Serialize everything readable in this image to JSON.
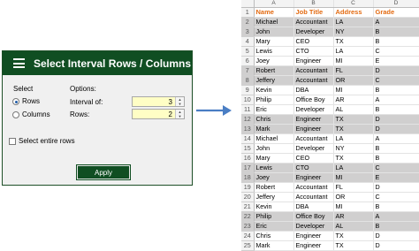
{
  "dialog": {
    "title": "Select Interval Rows / Columns",
    "select_group": {
      "label": "Select",
      "options": [
        {
          "label": "Rows",
          "checked": true
        },
        {
          "label": "Columns",
          "checked": false
        }
      ]
    },
    "options_group": {
      "label": "Options:",
      "interval_label": "Interval of:",
      "interval_value": "3",
      "rows_label": "Rows:",
      "rows_value": "2"
    },
    "select_entire_rows_label": "Select entire rows",
    "apply_label": "Apply"
  },
  "sheet": {
    "columns": [
      "A",
      "B",
      "C",
      "D"
    ],
    "rows": [
      {
        "n": "1",
        "cells": [
          "Name",
          "Job Title",
          "Address",
          "Grade"
        ],
        "header": true
      },
      {
        "n": "2",
        "cells": [
          "Michael",
          "Accountant",
          "LA",
          "A"
        ],
        "gray": true
      },
      {
        "n": "3",
        "cells": [
          "John",
          "Developer",
          "NY",
          "B"
        ],
        "gray": true
      },
      {
        "n": "4",
        "cells": [
          "Mary",
          "CEO",
          "TX",
          "B"
        ]
      },
      {
        "n": "5",
        "cells": [
          "Lewis",
          "CTO",
          "LA",
          "C"
        ]
      },
      {
        "n": "6",
        "cells": [
          "Joey",
          "Engineer",
          "MI",
          "E"
        ]
      },
      {
        "n": "7",
        "cells": [
          "Robert",
          "Accountant",
          "FL",
          "D"
        ],
        "gray": true
      },
      {
        "n": "8",
        "cells": [
          "Jeffery",
          "Accountant",
          "OR",
          "C"
        ],
        "gray": true
      },
      {
        "n": "9",
        "cells": [
          "Kevin",
          "DBA",
          "MI",
          "B"
        ]
      },
      {
        "n": "10",
        "cells": [
          "Philip",
          "Office Boy",
          "AR",
          "A"
        ]
      },
      {
        "n": "11",
        "cells": [
          "Eric",
          "Developer",
          "AL",
          "B"
        ]
      },
      {
        "n": "12",
        "cells": [
          "Chris",
          "Engineer",
          "TX",
          "D"
        ],
        "gray": true
      },
      {
        "n": "13",
        "cells": [
          "Mark",
          "Engineer",
          "TX",
          "D"
        ],
        "gray": true
      },
      {
        "n": "14",
        "cells": [
          "Michael",
          "Accountant",
          "LA",
          "A"
        ]
      },
      {
        "n": "15",
        "cells": [
          "John",
          "Developer",
          "NY",
          "B"
        ]
      },
      {
        "n": "16",
        "cells": [
          "Mary",
          "CEO",
          "TX",
          "B"
        ]
      },
      {
        "n": "17",
        "cells": [
          "Lewis",
          "CTO",
          "LA",
          "C"
        ],
        "gray": true
      },
      {
        "n": "18",
        "cells": [
          "Joey",
          "Engineer",
          "MI",
          "E"
        ],
        "gray": true
      },
      {
        "n": "19",
        "cells": [
          "Robert",
          "Accountant",
          "FL",
          "D"
        ]
      },
      {
        "n": "20",
        "cells": [
          "Jeffery",
          "Accountant",
          "OR",
          "C"
        ]
      },
      {
        "n": "21",
        "cells": [
          "Kevin",
          "DBA",
          "MI",
          "B"
        ]
      },
      {
        "n": "22",
        "cells": [
          "Philip",
          "Office Boy",
          "AR",
          "A"
        ],
        "gray": true
      },
      {
        "n": "23",
        "cells": [
          "Eric",
          "Developer",
          "AL",
          "B"
        ],
        "gray": true
      },
      {
        "n": "24",
        "cells": [
          "Chris",
          "Engineer",
          "TX",
          "D"
        ]
      },
      {
        "n": "25",
        "cells": [
          "Mark",
          "Engineer",
          "TX",
          "D"
        ]
      }
    ]
  },
  "colors": {
    "brand_green": "#104e22",
    "header_orange": "#e36b12",
    "highlight_gray": "#d0cfcf",
    "arrow_blue": "#4a7ec4"
  }
}
